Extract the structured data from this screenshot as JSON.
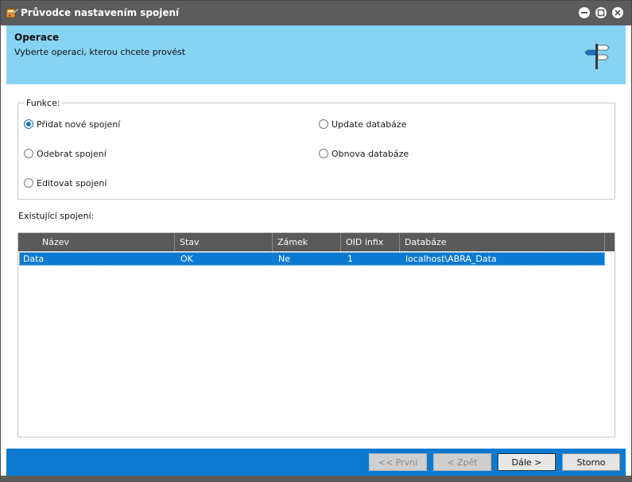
{
  "window": {
    "title": "Průvodce nastavením spojení",
    "title_icon": "wizard-app-icon",
    "controls": [
      "minimize-icon",
      "maximize-icon",
      "close-icon"
    ]
  },
  "header": {
    "title": "Operace",
    "subtitle": "Vyberte operaci, kterou chcete provést",
    "icon": "signpost-icon",
    "background": "#87d3f3"
  },
  "functions": {
    "legend": "Funkce:",
    "options": [
      {
        "label": "Přidat nové spojení",
        "checked": true
      },
      {
        "label": "Odebrat spojení",
        "checked": false
      },
      {
        "label": "Editovat spojení",
        "checked": false
      },
      {
        "label": "Update databáze",
        "checked": false
      },
      {
        "label": "Obnova databáze",
        "checked": false
      }
    ]
  },
  "connections": {
    "label": "Existující spojení:",
    "columns": [
      "Název",
      "Stav",
      "Zámek",
      "OID infix",
      "Databáze"
    ],
    "rows": [
      {
        "name": "Data",
        "state": "OK",
        "lock": "Ne",
        "oid_infix": "1",
        "database": "localhost\\ABRA_Data",
        "selected": true
      }
    ]
  },
  "footer": {
    "buttons": {
      "first": {
        "label": "<< První",
        "enabled": false
      },
      "back": {
        "label": "< Zpět",
        "enabled": false
      },
      "next": {
        "label": "Dále >",
        "enabled": true,
        "default": true
      },
      "cancel": {
        "label": "Storno",
        "enabled": true
      }
    },
    "accent": "#0c7ad0"
  }
}
